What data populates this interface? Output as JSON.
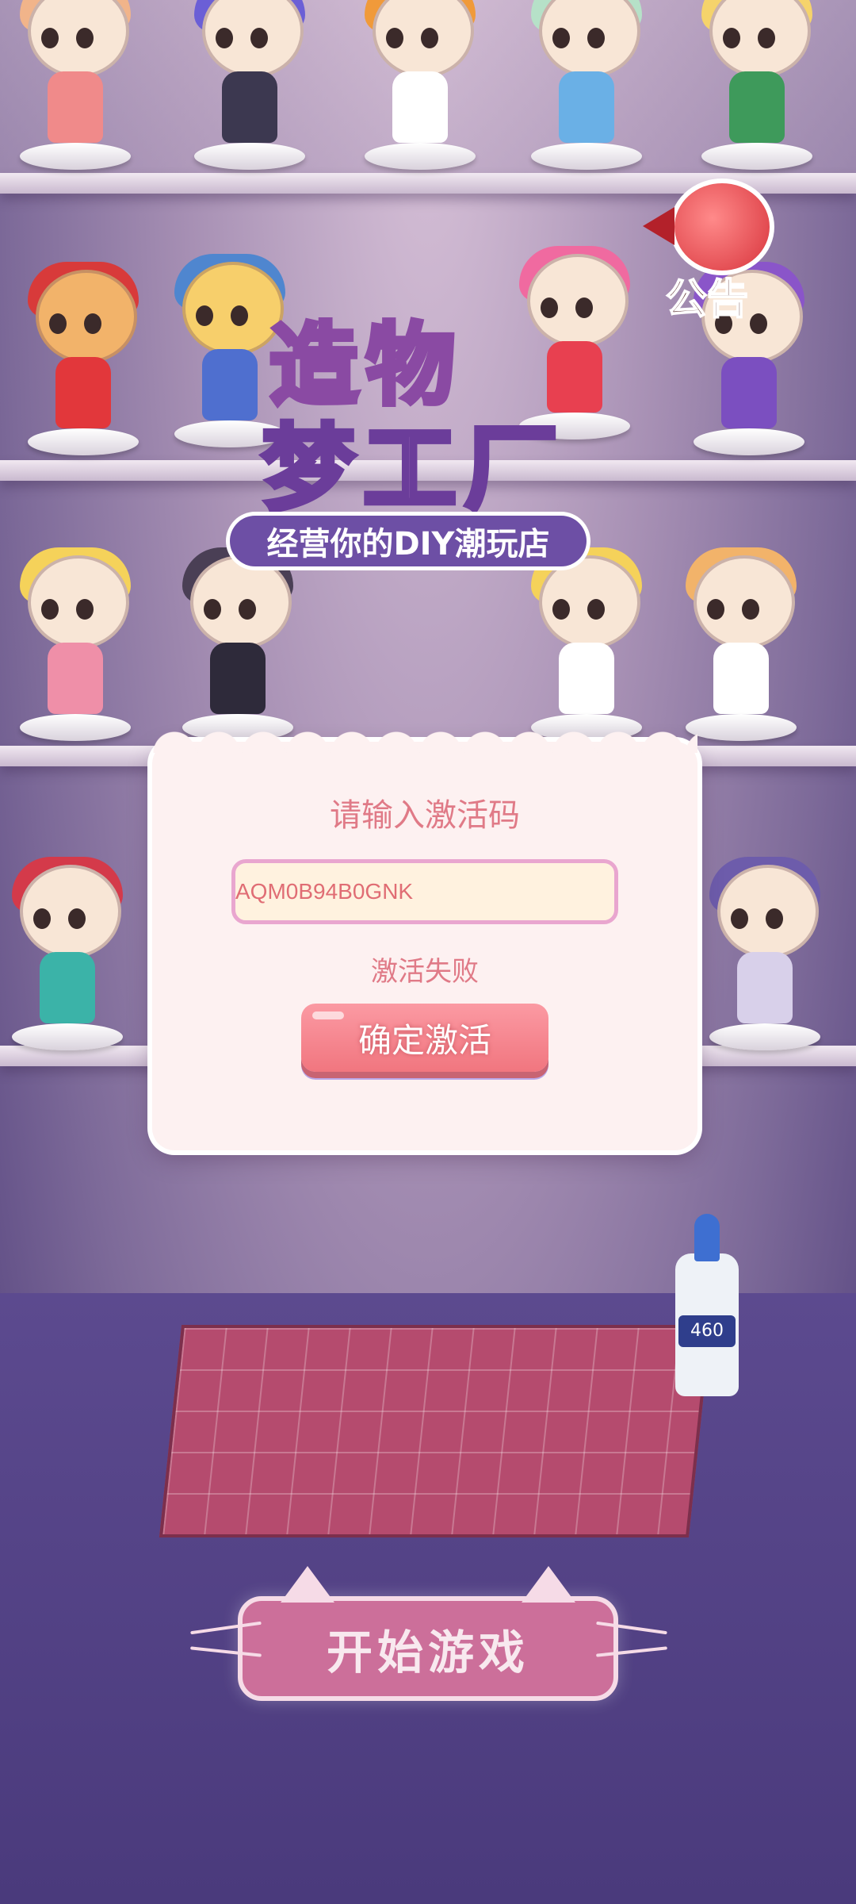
{
  "logo": {
    "line1": "造物",
    "line2": "梦工厂",
    "subtitle": "经营你的DIY潮玩店"
  },
  "announcement": {
    "label": "公告",
    "icon": "megaphone-icon"
  },
  "activation_dialog": {
    "title": "请输入激活码",
    "code_value": "AQM0B94B0GNK",
    "status": "激活失败",
    "confirm_label": "确定激活"
  },
  "glue": {
    "label": "460"
  },
  "start_button": {
    "label": "开始游戏"
  },
  "colors": {
    "dialog_bg": "#fdf1f1",
    "accent_pink": "#e07a87",
    "button_pink": "#f1767f",
    "start_button": "#cc6f9a"
  }
}
